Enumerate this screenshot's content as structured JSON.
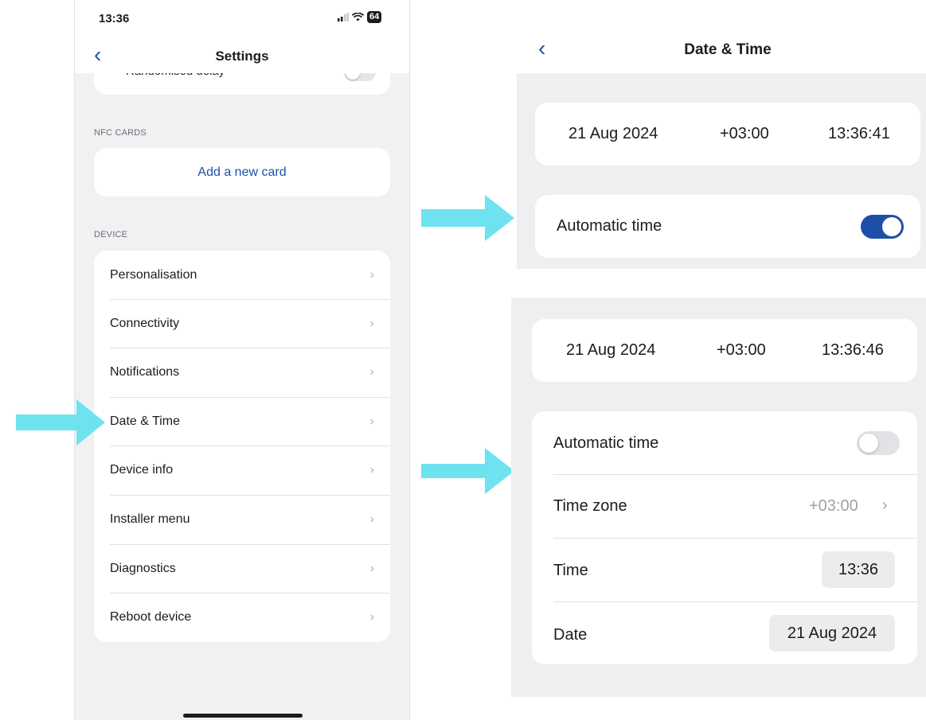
{
  "left": {
    "status_time": "13:36",
    "battery": "64",
    "nav_title": "Settings",
    "back_glyph": "‹",
    "cut_row_label": "Randomised delay",
    "nfc_section": "NFC CARDS",
    "add_card": "Add a new card",
    "device_section": "DEVICE",
    "items": [
      {
        "label": "Personalisation"
      },
      {
        "label": "Connectivity"
      },
      {
        "label": "Notifications"
      },
      {
        "label": "Date & Time"
      },
      {
        "label": "Device info"
      },
      {
        "label": "Installer menu"
      },
      {
        "label": "Diagnostics"
      },
      {
        "label": "Reboot device"
      }
    ]
  },
  "right": {
    "nav_title": "Date & Time",
    "back_glyph": "‹",
    "panel1": {
      "date": "21 Aug 2024",
      "offset": "+03:00",
      "time": "13:36:41",
      "automatic_label": "Automatic time"
    },
    "panel2": {
      "date": "21 Aug 2024",
      "offset": "+03:00",
      "time": "13:36:46",
      "automatic_label": "Automatic time",
      "timezone_label": "Time zone",
      "timezone_value": "+03:00",
      "time_label": "Time",
      "time_value": "13:36",
      "date_label": "Date",
      "date_value": "21 Aug 2024"
    }
  },
  "colors": {
    "accent": "#1e4fa8",
    "arrow": "#6ee3ef",
    "panel_bg": "#efeff1"
  },
  "icons": [
    "signal-icon",
    "wifi-icon",
    "battery-icon",
    "back-chevron-icon",
    "chevron-right-icon",
    "arrow-right-icon"
  ]
}
